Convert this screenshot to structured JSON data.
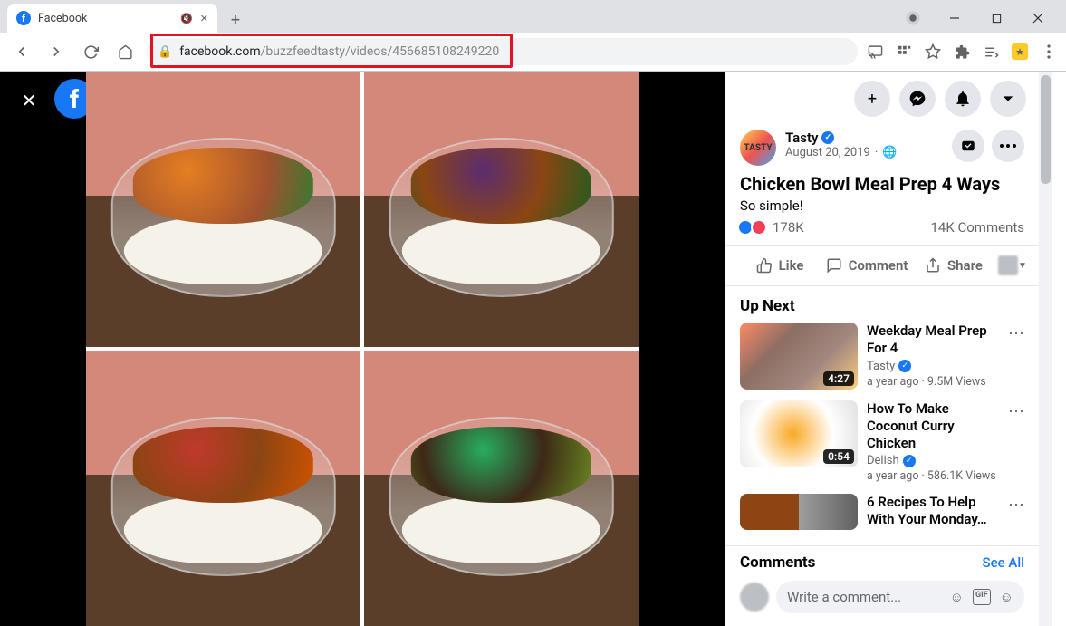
{
  "browser": {
    "tab_title": "Facebook",
    "url_host": "facebook.com",
    "url_path": "/buzzfeedtasty/videos/456685108249220"
  },
  "topbar": {
    "create_label": "+",
    "msg_label": "messenger",
    "notif_label": "notifications",
    "acct_label": "account"
  },
  "post": {
    "page_name": "Tasty",
    "avatar_text": "TASTY",
    "date": "August 20, 2019",
    "privacy": "Public",
    "title": "Chicken Bowl Meal Prep 4 Ways",
    "subtitle": "So simple!",
    "reactions": "178K",
    "comments": "14K Comments",
    "like_label": "Like",
    "comment_label": "Comment",
    "share_label": "Share"
  },
  "upnext": {
    "header": "Up Next",
    "items": [
      {
        "title": "Weekday Meal Prep For 4",
        "by": "Tasty",
        "stats": "a year ago · 9.5M Views",
        "duration": "4:27"
      },
      {
        "title": "How To Make Coconut Curry Chicken",
        "by": "Delish",
        "stats": "a year ago · 586.1K Views",
        "duration": "0:54"
      },
      {
        "title": "6 Recipes To Help With Your Monday…",
        "by": "",
        "stats": "",
        "duration": ""
      }
    ]
  },
  "comments": {
    "header": "Comments",
    "see_all": "See All",
    "placeholder": "Write a comment..."
  }
}
